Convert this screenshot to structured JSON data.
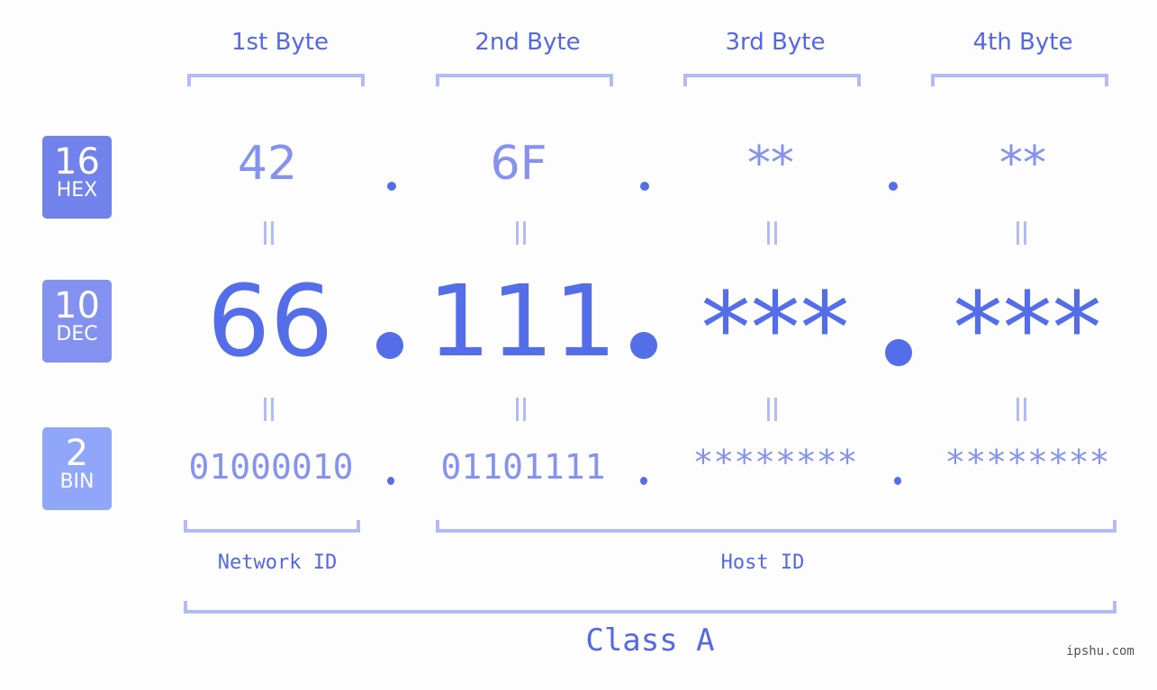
{
  "bytes": [
    {
      "label": "1st Byte",
      "hex": "42",
      "dec": "66",
      "bin": "01000010"
    },
    {
      "label": "2nd Byte",
      "hex": "6F",
      "dec": "111",
      "bin": "01101111"
    },
    {
      "label": "3rd Byte",
      "hex": "**",
      "dec": "***",
      "bin": "********"
    },
    {
      "label": "4th Byte",
      "hex": "**",
      "dec": "***",
      "bin": "********"
    }
  ],
  "badges": {
    "hex": {
      "num": "16",
      "label": "HEX",
      "color": "#7282ec"
    },
    "dec": {
      "num": "10",
      "label": "DEC",
      "color": "#8392f1"
    },
    "bin": {
      "num": "2",
      "label": "BIN",
      "color": "#90a7f9"
    }
  },
  "equals_symbol": "=",
  "network_label": "Network ID",
  "host_label": "Host ID",
  "class_label": "Class A",
  "watermark": "ipshu.com",
  "colors": {
    "accent": "#546de8",
    "light": "#8592ee",
    "bracket": "#b3bbf6"
  }
}
